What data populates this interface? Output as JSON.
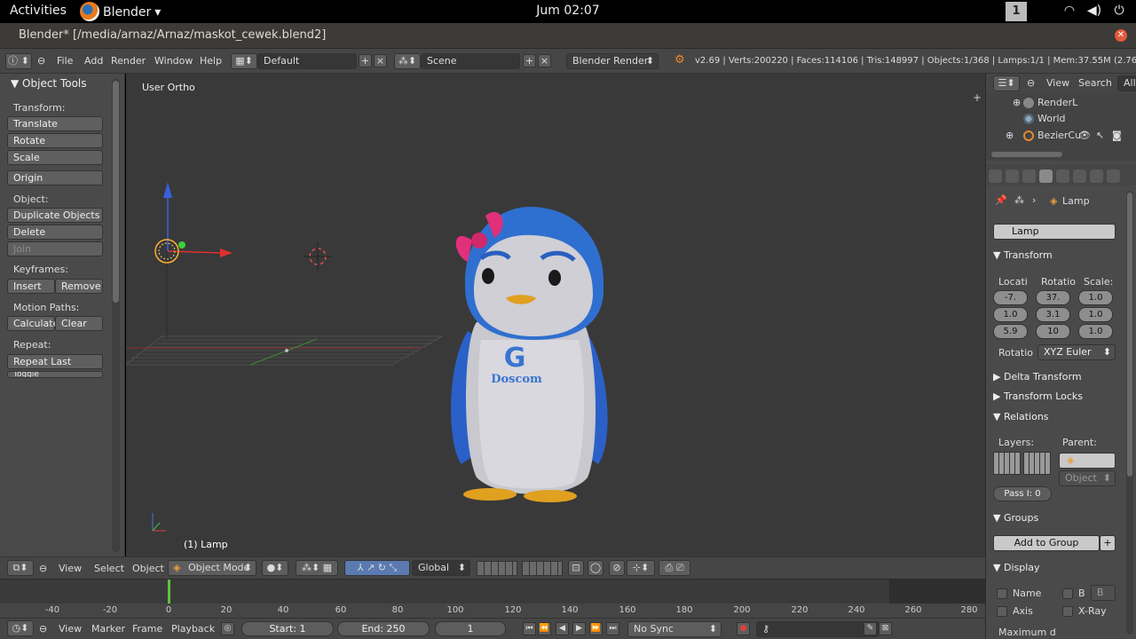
{
  "gnome": {
    "activities": "Activities",
    "app_name": "Blender",
    "clock": "Jum 02:07",
    "workspace": "1",
    "tray_icons": [
      "wifi-icon",
      "volume-icon",
      "power-icon"
    ]
  },
  "window": {
    "title": "Blender* [/media/arnaz/Arnaz/maskot_cewek.blend2]"
  },
  "info_header": {
    "menus": [
      "File",
      "Add",
      "Render",
      "Window",
      "Help"
    ],
    "screen_layout": "Default",
    "scene": "Scene",
    "render_engine": "Blender Render",
    "stats": "v2.69 | Verts:200220 | Faces:114106 | Tris:148997 | Objects:1/368 | Lamps:1/1 | Mem:37.55M (2.76M)"
  },
  "tool_shelf": {
    "panel_title": "Object Tools",
    "transform_label": "Transform:",
    "translate": "Translate",
    "rotate": "Rotate",
    "scale": "Scale",
    "origin": "Origin",
    "object_label": "Object:",
    "duplicate_objects": "Duplicate Objects",
    "delete": "Delete",
    "join": "Join",
    "keyframes_label": "Keyframes:",
    "insert": "Insert",
    "remove": "Remove",
    "motion_paths_label": "Motion Paths:",
    "calculate": "Calculate",
    "clear": "Clear",
    "repeat_label": "Repeat:",
    "repeat_last": "Repeat Last",
    "toggle_cut": "Toggle"
  },
  "viewport": {
    "view_label": "User Ortho",
    "object_label": "(1) Lamp",
    "mascot_logo": "Doscom"
  },
  "view3d_header": {
    "menus": [
      "View",
      "Select",
      "Object"
    ],
    "mode": "Object Mode",
    "orientation": "Global"
  },
  "timeline": {
    "ticks": [
      "-40",
      "-20",
      "0",
      "20",
      "40",
      "60",
      "80",
      "100",
      "120",
      "140",
      "160",
      "180",
      "200",
      "220",
      "240",
      "260",
      "280"
    ],
    "current_frame_marker": 0
  },
  "timeline_header": {
    "menus": [
      "View",
      "Marker",
      "Frame",
      "Playback"
    ],
    "start": "Start: 1",
    "end": "End: 250",
    "current": "1",
    "sync": "No Sync"
  },
  "outliner": {
    "menus": [
      "View",
      "Search",
      "All"
    ],
    "items": [
      "RenderL",
      "World",
      "BezierCu"
    ]
  },
  "properties": {
    "breadcrumb": "Lamp",
    "object_name": "Lamp",
    "transform_title": "Transform",
    "location_label": "Locati",
    "rotation_label": "Rotatio",
    "scale_label": "Scale:",
    "location": [
      "-7.",
      "1.0",
      "5.9"
    ],
    "rotation": [
      "37.",
      "3.1",
      "10"
    ],
    "scale": [
      "1.0",
      "1.0",
      "1.0"
    ],
    "rotation_mode_label": "Rotatio",
    "rotation_mode": "XYZ Euler",
    "delta_transform": "Delta Transform",
    "transform_locks": "Transform Locks",
    "relations": "Relations",
    "layers_label": "Layers:",
    "parent_label": "Parent:",
    "parent_type": "Object",
    "pass_index": "Pass I: 0",
    "groups": "Groups",
    "add_to_group": "Add to Group",
    "display": "Display",
    "name_label": "Name",
    "b_label": "B",
    "axis_label": "Axis",
    "xray_label": "X-Ray",
    "maximum_draw": "Maximum d"
  },
  "colors": {
    "viewport_bg": "#393939",
    "panel_bg": "#4a4a4a",
    "penguin_blue": "#2f6fd0",
    "bow_pink": "#e0307a",
    "playhead_green": "#5ec43a"
  }
}
